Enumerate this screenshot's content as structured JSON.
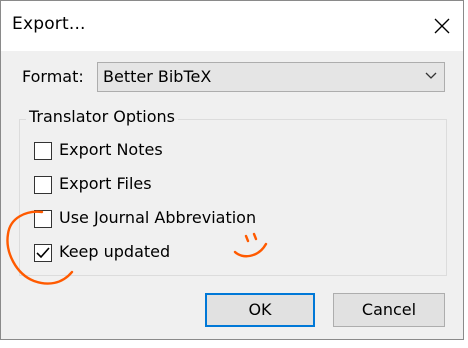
{
  "window": {
    "title": "Export..."
  },
  "format": {
    "label": "Format:",
    "selected": "Better BibTeX"
  },
  "translator_options": {
    "title": "Translator Options",
    "options": [
      {
        "label": "Export Notes",
        "checked": false
      },
      {
        "label": "Export Files",
        "checked": false
      },
      {
        "label": "Use Journal Abbreviation",
        "checked": false
      },
      {
        "label": "Keep updated",
        "checked": true
      }
    ]
  },
  "buttons": {
    "ok": "OK",
    "cancel": "Cancel"
  },
  "colors": {
    "accent": "#0078d7",
    "annotation": "#ff5a00"
  }
}
